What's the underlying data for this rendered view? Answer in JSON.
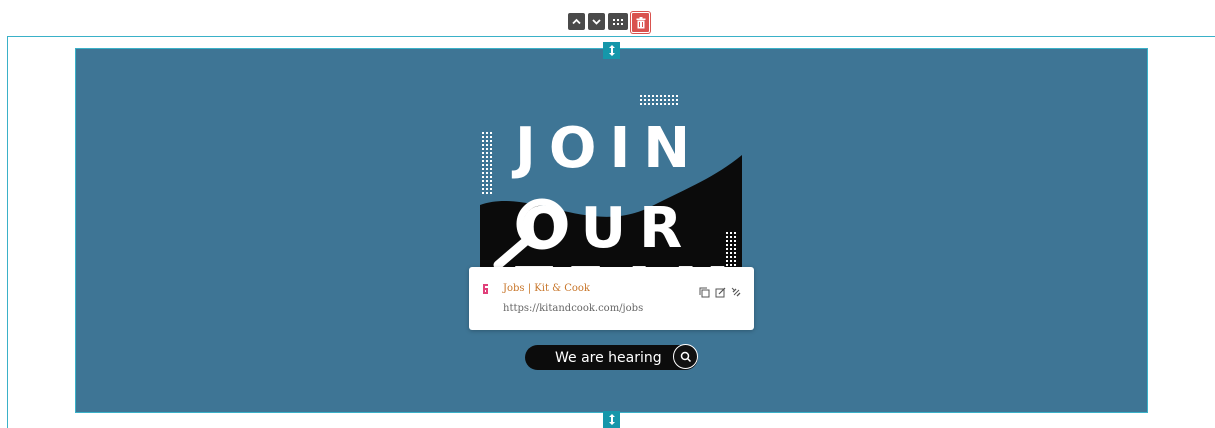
{
  "toolbar": {
    "buttons": [
      {
        "name": "move-up-button",
        "icon": "chevron-up-icon"
      },
      {
        "name": "move-down-button",
        "icon": "chevron-down-icon"
      },
      {
        "name": "block-grid-button",
        "icon": "grid-dots-icon"
      },
      {
        "name": "delete-button",
        "icon": "trash-icon"
      }
    ]
  },
  "section": {
    "background_color": "#3e7595",
    "outline_color": "#3ab1c8",
    "handle_color": "#1597aa"
  },
  "hero": {
    "headline_lines": [
      "JOIN",
      "OUR",
      "TEAM"
    ],
    "icon": "magnifier-icon"
  },
  "search": {
    "label": "We are hearing",
    "icon": "search-icon"
  },
  "link_popover": {
    "title": "Jobs | Kit & Cook",
    "url": "https://kitandcook.com/jobs",
    "title_color": "#c8762a",
    "actions": [
      "copy-icon",
      "edit-icon",
      "unlink-icon"
    ]
  }
}
